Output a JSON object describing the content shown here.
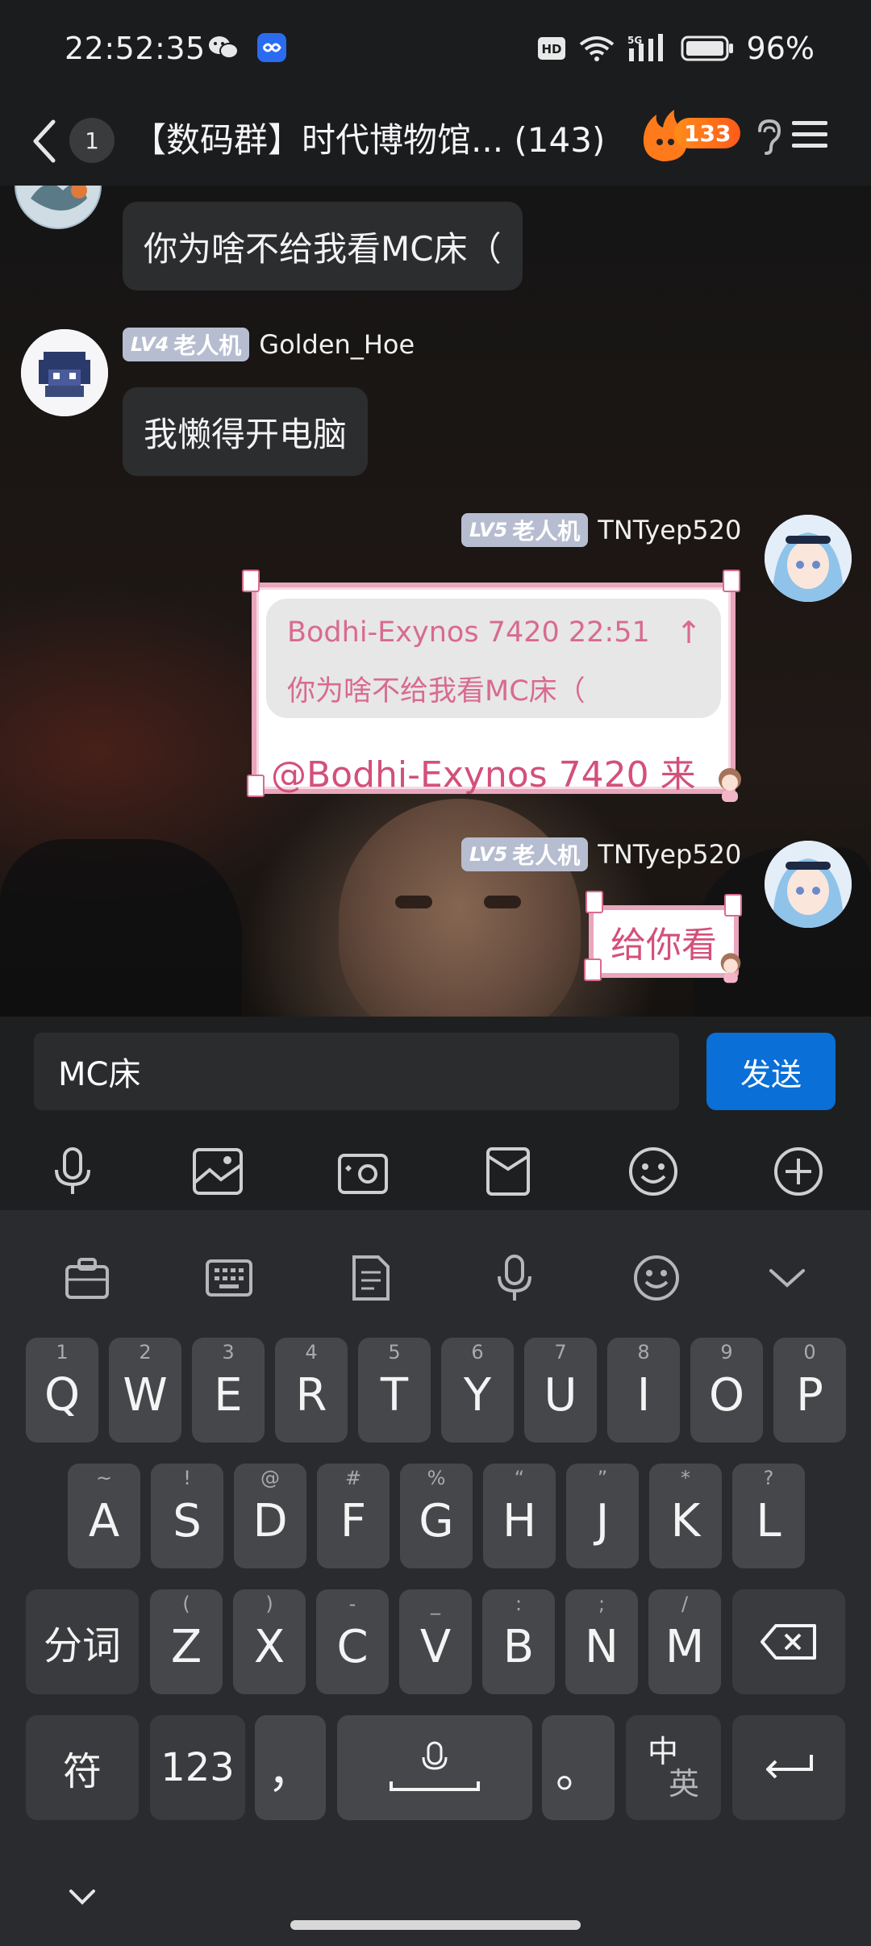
{
  "status": {
    "time": "22:52:35",
    "hd_label": "HD",
    "net_label": "5G",
    "battery": "96%"
  },
  "header": {
    "unread_count": "1",
    "title": "【数码群】时代博物馆...  (143)",
    "fire_count": "133"
  },
  "messages": [
    {
      "side": "left",
      "text": "你为啥不给我看MC床（"
    },
    {
      "side": "left",
      "level": "LV4",
      "level_title": "老人机",
      "sender": "Golden_Hoe",
      "text": "我懒得开电脑"
    },
    {
      "side": "right",
      "level": "LV5",
      "level_title": "老人机",
      "sender": "TNTyep520",
      "reply": {
        "quote_meta": "Bodhi-Exynos 7420 22:51",
        "quote_arrow": "↑",
        "quote_text": "你为啥不给我看MC床（",
        "text": "@Bodhi-Exynos 7420 来"
      }
    },
    {
      "side": "right",
      "level": "LV5",
      "level_title": "老人机",
      "sender": "TNTyep520",
      "text": "给你看"
    }
  ],
  "composer": {
    "input_value": "MC床",
    "send_label": "发送",
    "tools": [
      "microphone-icon",
      "image-icon",
      "camera-icon",
      "gift-icon",
      "emoji-icon",
      "plus-icon"
    ]
  },
  "keyboard": {
    "toolbar": [
      "clipboard-icon",
      "keyboard-icon",
      "document-icon",
      "microphone-icon",
      "emoji-icon",
      "collapse-icon"
    ],
    "row1": [
      {
        "k": "Q",
        "h": "1"
      },
      {
        "k": "W",
        "h": "2"
      },
      {
        "k": "E",
        "h": "3"
      },
      {
        "k": "R",
        "h": "4"
      },
      {
        "k": "T",
        "h": "5"
      },
      {
        "k": "Y",
        "h": "6"
      },
      {
        "k": "U",
        "h": "7"
      },
      {
        "k": "I",
        "h": "8"
      },
      {
        "k": "O",
        "h": "9"
      },
      {
        "k": "P",
        "h": "0"
      }
    ],
    "row2": [
      {
        "k": "A",
        "h": "~"
      },
      {
        "k": "S",
        "h": "!"
      },
      {
        "k": "D",
        "h": "@"
      },
      {
        "k": "F",
        "h": "#"
      },
      {
        "k": "G",
        "h": "%"
      },
      {
        "k": "H",
        "h": "“"
      },
      {
        "k": "J",
        "h": "”"
      },
      {
        "k": "K",
        "h": "*"
      },
      {
        "k": "L",
        "h": "?"
      }
    ],
    "row3_left": "分词",
    "row3": [
      {
        "k": "Z",
        "h": "("
      },
      {
        "k": "X",
        "h": ")"
      },
      {
        "k": "C",
        "h": "-"
      },
      {
        "k": "V",
        "h": "_"
      },
      {
        "k": "B",
        "h": ":"
      },
      {
        "k": "N",
        "h": ";"
      },
      {
        "k": "M",
        "h": "/"
      }
    ],
    "row4": {
      "symbols": "符",
      "numbers": "123",
      "comma": "，",
      "period": "。",
      "lang_top": "中",
      "lang_bottom": "英"
    }
  }
}
